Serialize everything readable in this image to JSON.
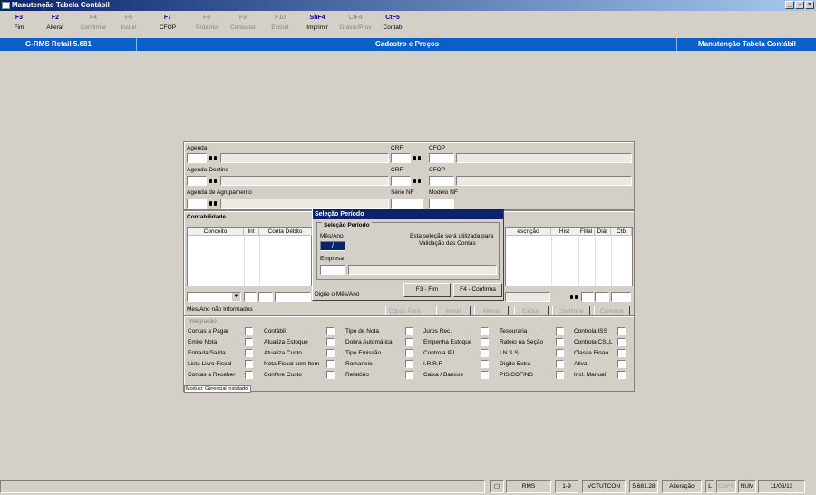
{
  "window": {
    "title": "Manutenção Tabela Contábil"
  },
  "toolbar": [
    {
      "key": "F3",
      "label": "Fim",
      "enabled": true
    },
    {
      "key": "F2",
      "label": "Alterar",
      "enabled": true
    },
    {
      "key": "F4",
      "label": "Confirmar",
      "enabled": false
    },
    {
      "key": "F6",
      "label": "Incluir",
      "enabled": false
    },
    {
      "key": "F7",
      "label": "CFOP",
      "enabled": true
    },
    {
      "key": "F8",
      "label": "Próximo",
      "enabled": false
    },
    {
      "key": "F9",
      "label": "Consultar",
      "enabled": false
    },
    {
      "key": "F10",
      "label": "Excluir",
      "enabled": false
    },
    {
      "key": "ShF4",
      "label": "Imprimir",
      "enabled": true
    },
    {
      "key": "CtF4",
      "label": "Gravar/Prox",
      "enabled": false
    },
    {
      "key": "CtF5",
      "label": "Contab",
      "enabled": true
    }
  ],
  "banner": {
    "app": "G-RMS Retail 5.681",
    "section": "Cadastro e Preços",
    "screen": "Manutenção Tabela Contábil"
  },
  "form": {
    "agenda": "Agenda",
    "agenda_destino": "Agenda Destino",
    "agenda_agrupamento": "Agenda de Agrupamento",
    "crf": "CRF",
    "crf2": "CRF",
    "cfop": "CFOP",
    "cfop2": "CFOP",
    "serie_nf": "Série NF",
    "modelo_nf": "Modelo NF",
    "contabilidade": "Contabilidade",
    "grid_headers_left": [
      "Conceito",
      "Int",
      "Conta Débito"
    ],
    "grid_headers_right": [
      "escrição",
      "Hist",
      "Filial",
      "Diár",
      "Ctb"
    ],
    "mes_ano_nao_informados": "Mes/Ano não Informados",
    "buttons": [
      "Copiar Para",
      "Incluir",
      "Alterar",
      "Excluir",
      "Confirmar",
      "Cancelar"
    ]
  },
  "integracao": {
    "title": "Integração",
    "columns": [
      [
        "Contas a Pagar",
        "Emite Nota",
        "Entrada/Saída",
        "Lista Livro Fiscal",
        "Contas a Receber"
      ],
      [
        "Contábil",
        "Atualiza Estoque",
        "Atualiza Custo",
        "Nota Fiscal com Item",
        "Confere Custo"
      ],
      [
        "Tipo de Nota",
        "Dobra Automática",
        "Tipo Emissão",
        "Romaneio",
        "Relatório"
      ],
      [
        "Juros Rec.",
        "Empenha Estoque",
        "Controla IPI",
        "I.R.R.F.",
        "Caixa / Bancos"
      ],
      [
        "Tesouraria",
        "Rateio na Seção",
        "I.N.S.S.",
        "Dígito Extra",
        "PIS/COFINS"
      ],
      [
        "Controla ISS",
        "Controla CSLL",
        "Classe Finan.",
        "Ativa",
        "Incl. Manual"
      ]
    ],
    "footer": "Modulo: Gerencial instalado."
  },
  "dialog": {
    "title": "Seleção Período",
    "group": "Seleção Período",
    "mes_ano_label": "Mês/Ano",
    "mes_ano_value": "/",
    "info_line1": "Esta seleção será utilizada para",
    "info_line2": "Validação das Contas",
    "empresa_label": "Empresa",
    "hint": "Digite o Mês/Ano",
    "btn_fim": "F3 - Fim",
    "btn_confirma": "F4 - Confirma"
  },
  "status": {
    "rms": "RMS",
    "page": "1-9",
    "user": "VCTUTCON",
    "version": "5.681.28",
    "mode": "Alteração",
    "l": "L",
    "caps": "CAPS",
    "num": "NUM",
    "date": "11/06/13"
  }
}
